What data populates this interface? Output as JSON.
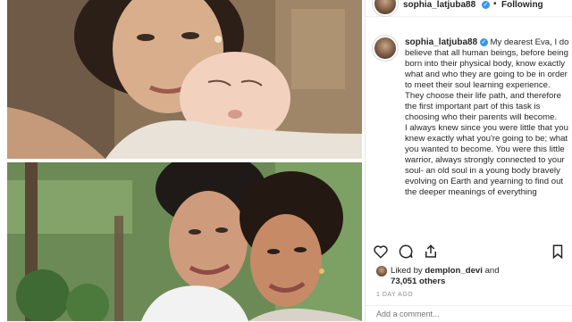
{
  "header": {
    "username": "sophia_latjuba88",
    "separator": "•",
    "follow_label": "Following"
  },
  "caption": {
    "username": "sophia_latjuba88",
    "paragraph1": "My dearest Eva, I do believe that all human beings, before being born into their physical body, know exactly what and who they are going to be in order to meet their soul learning experience. They choose their life path, and therefore the first important part of this task is choosing who their parents will become.",
    "paragraph2": "I always knew since you were little that you knew exactly what you're going to be; what you wanted to become. You were this little warrior, always strongly connected to your soul- an old soul in a young body bravely evolving on Earth and yearning to find out the deeper meanings of everything"
  },
  "actions": {
    "like_icon": "heart-icon",
    "comment_icon": "comment-icon",
    "share_icon": "share-icon",
    "save_icon": "bookmark-icon"
  },
  "likes": {
    "prefix": "Liked by",
    "liker": "demplon_devi",
    "and": "and",
    "count": "73,051 others"
  },
  "timestamp": "1 DAY AGO",
  "comment": {
    "placeholder": "Add a comment..."
  }
}
